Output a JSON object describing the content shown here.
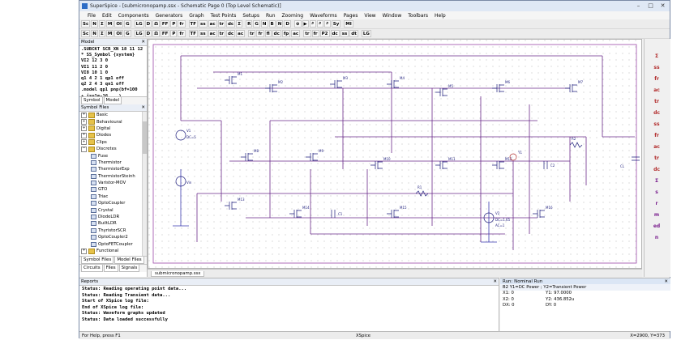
{
  "window": {
    "title": "SuperSpice - [submicronopamp.ssx - Schematic Page 0 (Top Level Schematic)]",
    "min": "–",
    "max": "□",
    "close": "✕"
  },
  "menu": [
    "File",
    "Edit",
    "Components",
    "Generators",
    "Graph",
    "Test Points",
    "Setups",
    "Run",
    "Zooming",
    "Waveforms",
    "Pages",
    "View",
    "Window",
    "Toolbars",
    "Help"
  ],
  "toolbar1": [
    "Sc",
    "N",
    "Σ",
    "M",
    "OI",
    "G",
    "LG",
    "D",
    "Ω",
    "FF",
    "P",
    "fr",
    "TF",
    "ss",
    "ac",
    "tr",
    "dc",
    "Σ",
    "R",
    "G",
    "N",
    "B",
    "N",
    "D",
    "⊕",
    "▶",
    "⌕",
    "⌕",
    "⌕",
    "Sy",
    "MI"
  ],
  "toolbar2": [
    "Sc",
    "N",
    "Σ",
    "M",
    "OI",
    "G",
    "LG",
    "D",
    "Ω",
    "FF",
    "P",
    "fr",
    "TF",
    "ss",
    "ac",
    "tr",
    "dc",
    "ac",
    "tr",
    "fr",
    "fl",
    "dc",
    "fp",
    "ac",
    "tr",
    "fr",
    "P2",
    "dc",
    "ss",
    "dt",
    "LG"
  ],
  "model_panel": {
    "title": "Model",
    "lines": [
      ".SUBCKT SCR_XN 18 11 12",
      "* SS_Symbol {system}",
      "VI2 12 3 0",
      "VI1 11 2 0",
      "VI8 10 1 0",
      "q1 4 2 1 qp1 off",
      "q2 2 4 3 qn1 off",
      ".model qp1 pnp(bf=100",
      "+ is=1e-16 ...)"
    ],
    "tabs": [
      "Symbol",
      "Model"
    ]
  },
  "symbol_files": {
    "title": "Symbol Files",
    "items": [
      {
        "label": "Basic",
        "kind": "folder",
        "expander": "+"
      },
      {
        "label": "Behavioural",
        "kind": "folder",
        "expander": "+"
      },
      {
        "label": "Digital",
        "kind": "folder",
        "expander": "+"
      },
      {
        "label": "Diodes",
        "kind": "folder",
        "expander": "+"
      },
      {
        "label": "Clips",
        "kind": "folder",
        "expander": "+"
      },
      {
        "label": "Discretes",
        "kind": "folder",
        "expander": "−"
      },
      {
        "label": "Fuse",
        "kind": "comp"
      },
      {
        "label": "Thermistor",
        "kind": "comp"
      },
      {
        "label": "ThermistorExp",
        "kind": "comp"
      },
      {
        "label": "ThermistorSteinh",
        "kind": "comp"
      },
      {
        "label": "Varistor-MOV",
        "kind": "comp"
      },
      {
        "label": "GTO",
        "kind": "comp"
      },
      {
        "label": "Triac",
        "kind": "comp"
      },
      {
        "label": "OptoCoupler",
        "kind": "comp"
      },
      {
        "label": "Crystal",
        "kind": "comp"
      },
      {
        "label": "DiodeLDR",
        "kind": "comp"
      },
      {
        "label": "BuiltLDR",
        "kind": "comp"
      },
      {
        "label": "ThyristorSCR",
        "kind": "comp"
      },
      {
        "label": "OptoCoupler2",
        "kind": "comp"
      },
      {
        "label": "OptoFETCoupler",
        "kind": "comp"
      },
      {
        "label": "Functional",
        "kind": "folder",
        "expander": "+"
      }
    ],
    "tabs": [
      "Symbol Files",
      "Model Files"
    ],
    "subtabs": [
      "Circuits",
      "Files",
      "Signals"
    ]
  },
  "schematic": {
    "tab_label": "submicronopamp.ssx",
    "components": [
      {
        "label": "V1"
      },
      {
        "label": "DC=5"
      },
      {
        "label": "M1"
      },
      {
        "label": "M2"
      },
      {
        "label": "M3"
      },
      {
        "label": "M4"
      },
      {
        "label": "M5"
      },
      {
        "label": "M6"
      },
      {
        "label": "M7"
      },
      {
        "label": "M8"
      },
      {
        "label": "M9"
      },
      {
        "label": "M10"
      },
      {
        "label": "M11"
      },
      {
        "label": "M12"
      },
      {
        "label": "M13"
      },
      {
        "label": "M14"
      },
      {
        "label": "M15"
      },
      {
        "label": "M16"
      },
      {
        "label": "R1"
      },
      {
        "label": "R2"
      },
      {
        "label": "C1"
      },
      {
        "label": "C2"
      },
      {
        "label": "CL"
      },
      {
        "label": "Y1"
      },
      {
        "label": "V2"
      },
      {
        "label": "DC=1.65"
      },
      {
        "label": "AC=1"
      },
      {
        "label": "Vin"
      }
    ]
  },
  "right_bar": [
    "Σ",
    "ss",
    "fr",
    "ac",
    "tr",
    "dc",
    "ss",
    "fr",
    "ac",
    "tr",
    "dc",
    "Σ",
    "s",
    "r",
    "m",
    "ed",
    "n"
  ],
  "reports": {
    "title": "Reports",
    "lines": [
      "Status: Reading operating point data...",
      "Status: Reading Transient data...",
      "Start of XSpice log file:",
      "End of XSpice log file:",
      "Status: Waveform graphs updated",
      "Status: Data loaded successfully"
    ]
  },
  "run_panel": {
    "title": "Run: Nominal Run",
    "header": "B2 Y1=DC Power ; Y2=Transient Power",
    "rows": [
      {
        "a": "X1: 0",
        "b": "Y1: 97.0000",
        "c": ""
      },
      {
        "a": "X2: 0",
        "b": "Y2: 436.852u",
        "c": ""
      },
      {
        "a": "DX: 0",
        "b": "DY: 0",
        "c": ""
      }
    ]
  },
  "statusbar": {
    "left": "For Help, press F1",
    "mid": "XSpice",
    "right": "X=2900, Y=373"
  }
}
